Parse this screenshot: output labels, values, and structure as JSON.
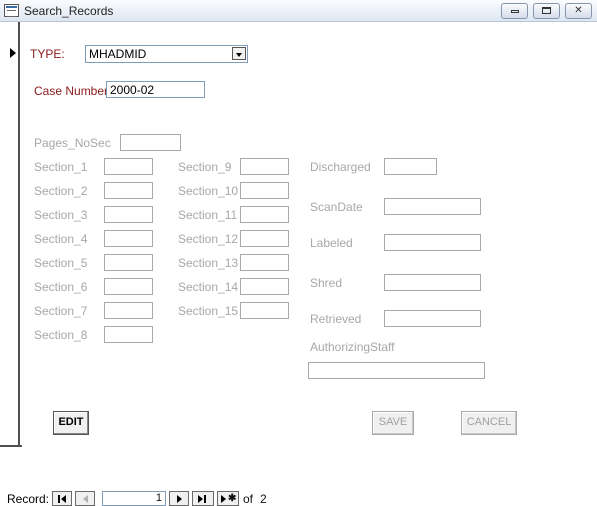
{
  "window": {
    "title": "Search_Records"
  },
  "form": {
    "type_label": "TYPE:",
    "type_value": "MHADMID",
    "case_label": "Case Number:",
    "case_value": "2000-02",
    "pages_label": "Pages_NoSec",
    "sections_left": [
      "Section_1",
      "Section_2",
      "Section_3",
      "Section_4",
      "Section_5",
      "Section_6",
      "Section_7",
      "Section_8"
    ],
    "sections_mid": [
      "Section_9",
      "Section_10",
      "Section_11",
      "Section_12",
      "Section_13",
      "Section_14",
      "Section_15"
    ],
    "right_labels": {
      "discharged": "Discharged",
      "scandate": "ScanDate",
      "labeled": "Labeled",
      "shred": "Shred",
      "retrieved": "Retrieved",
      "authorizing": "AuthorizingStaff"
    }
  },
  "buttons": {
    "edit": "EDIT",
    "save": "SAVE",
    "cancel": "CANCEL"
  },
  "navigation": {
    "label": "Record:",
    "current": "1",
    "of_label": "of",
    "total": "2"
  },
  "icons": [
    "form-icon",
    "minimize-icon",
    "maximize-icon",
    "close-icon",
    "combo-arrow-icon",
    "record-pointer-icon",
    "first-record-icon",
    "previous-record-icon",
    "next-record-icon",
    "last-record-icon",
    "new-record-icon"
  ]
}
